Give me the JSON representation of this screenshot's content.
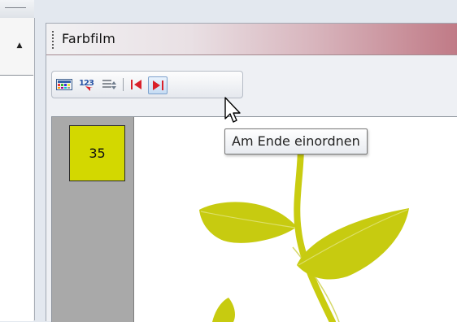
{
  "window": {
    "title": "Farbfilm"
  },
  "left_panel": {
    "scroll_up_icon": "triangle-up"
  },
  "toolbar": {
    "buttons": [
      {
        "id": "palette",
        "icon": "palette-icon",
        "tooltip": ""
      },
      {
        "id": "numbering",
        "icon": "numbering-icon",
        "tooltip": ""
      },
      {
        "id": "list-sort",
        "icon": "list-sort-icon",
        "tooltip": ""
      },
      {
        "id": "move-to-start",
        "icon": "move-to-start-icon",
        "tooltip": ""
      },
      {
        "id": "move-to-end",
        "icon": "move-to-end-icon",
        "tooltip": "Am Ende einordnen"
      }
    ]
  },
  "color_strip": {
    "items": [
      {
        "number": "35",
        "color": "#d3d800"
      }
    ]
  },
  "tooltip": {
    "text": "Am Ende einordnen"
  },
  "colors": {
    "accent": "#d3d800",
    "header_red": "#c07a86",
    "icon_red": "#d9202a"
  }
}
